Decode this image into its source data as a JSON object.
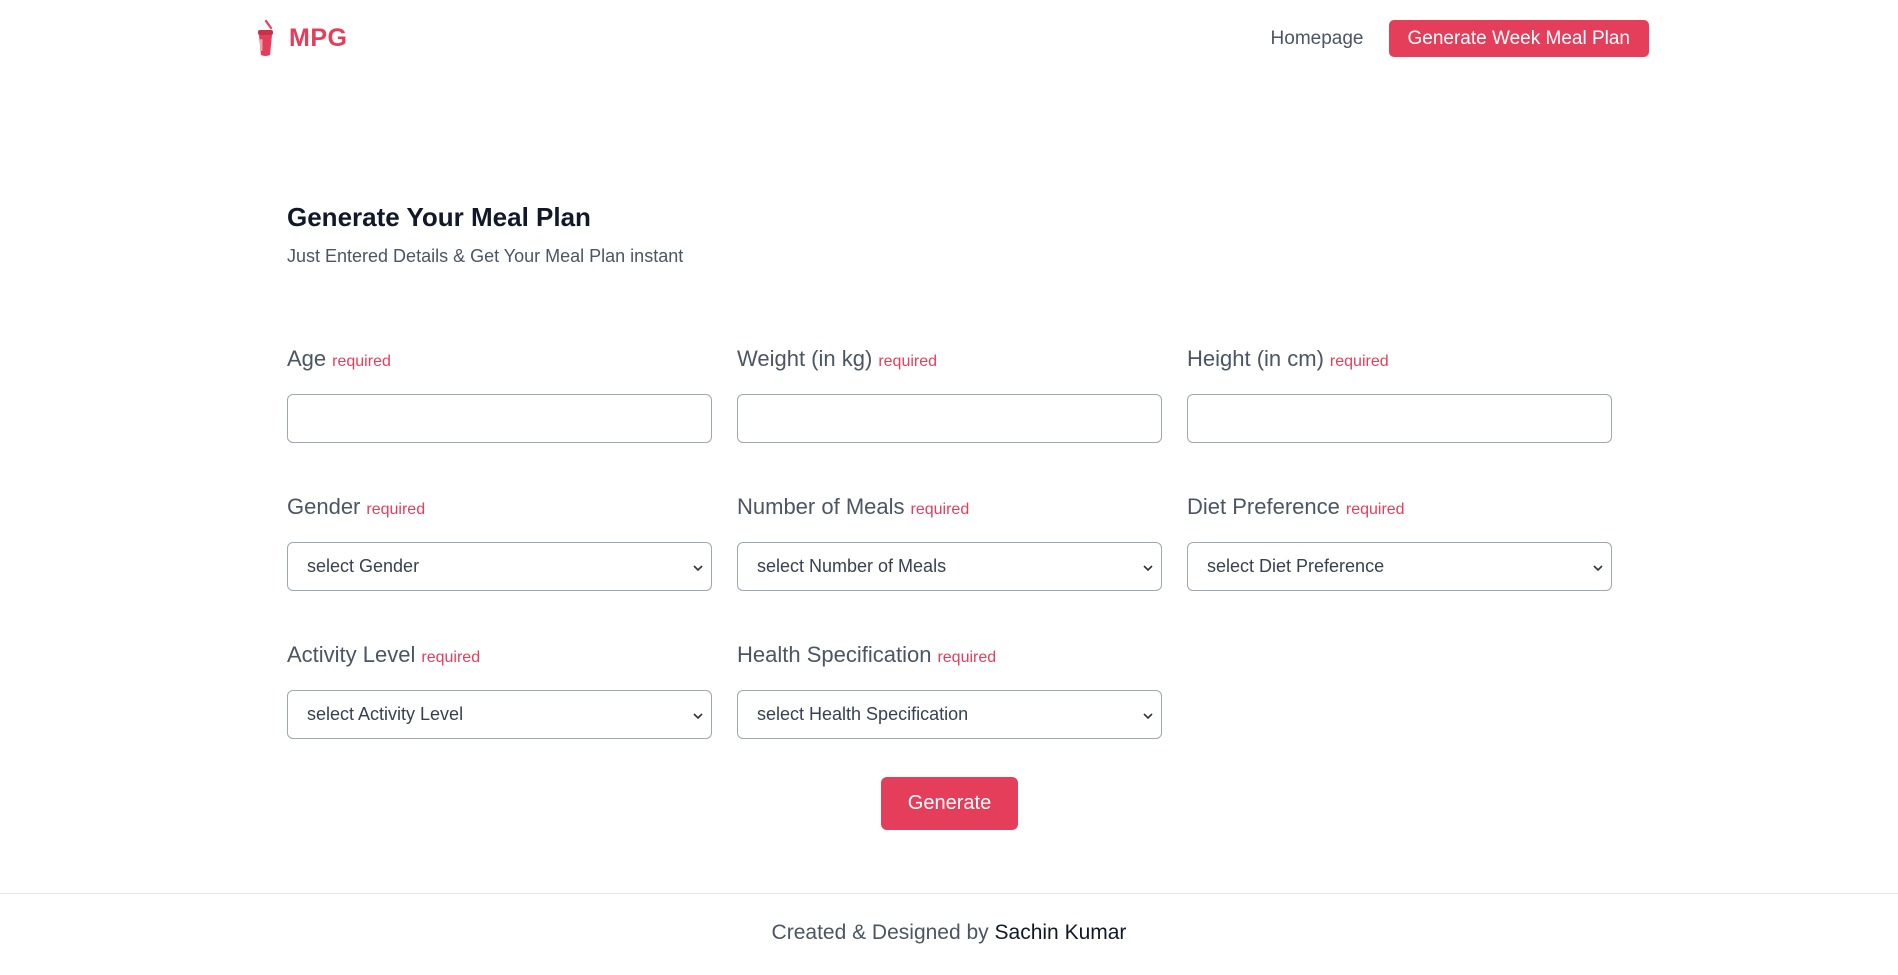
{
  "header": {
    "brand": "MPG",
    "nav": {
      "homepage": "Homepage",
      "cta": "Generate Week Meal Plan"
    }
  },
  "main": {
    "title": "Generate Your Meal Plan",
    "subtitle": "Just Entered Details & Get Your Meal Plan instant",
    "required_text": "required",
    "fields": {
      "age": {
        "label": "Age",
        "value": ""
      },
      "weight": {
        "label": "Weight (in kg)",
        "value": ""
      },
      "height": {
        "label": "Height (in cm)",
        "value": ""
      },
      "gender": {
        "label": "Gender",
        "selected": "select Gender"
      },
      "meals": {
        "label": "Number of Meals",
        "selected": "select Number of Meals"
      },
      "diet": {
        "label": "Diet Preference",
        "selected": "select Diet Preference"
      },
      "activity": {
        "label": "Activity Level",
        "selected": "select Activity Level"
      },
      "health": {
        "label": "Health Specification",
        "selected": "select Health Specification"
      }
    },
    "generate_label": "Generate"
  },
  "footer": {
    "prefix": "Created & Designed by",
    "author": "Sachin Kumar"
  },
  "colors": {
    "accent": "#e53e5b",
    "text": "#4b5563",
    "heading": "#111827",
    "border": "#a0a7b2"
  },
  "icons": {
    "logo": "drink-cup-icon",
    "select": "chevron-down-icon"
  }
}
